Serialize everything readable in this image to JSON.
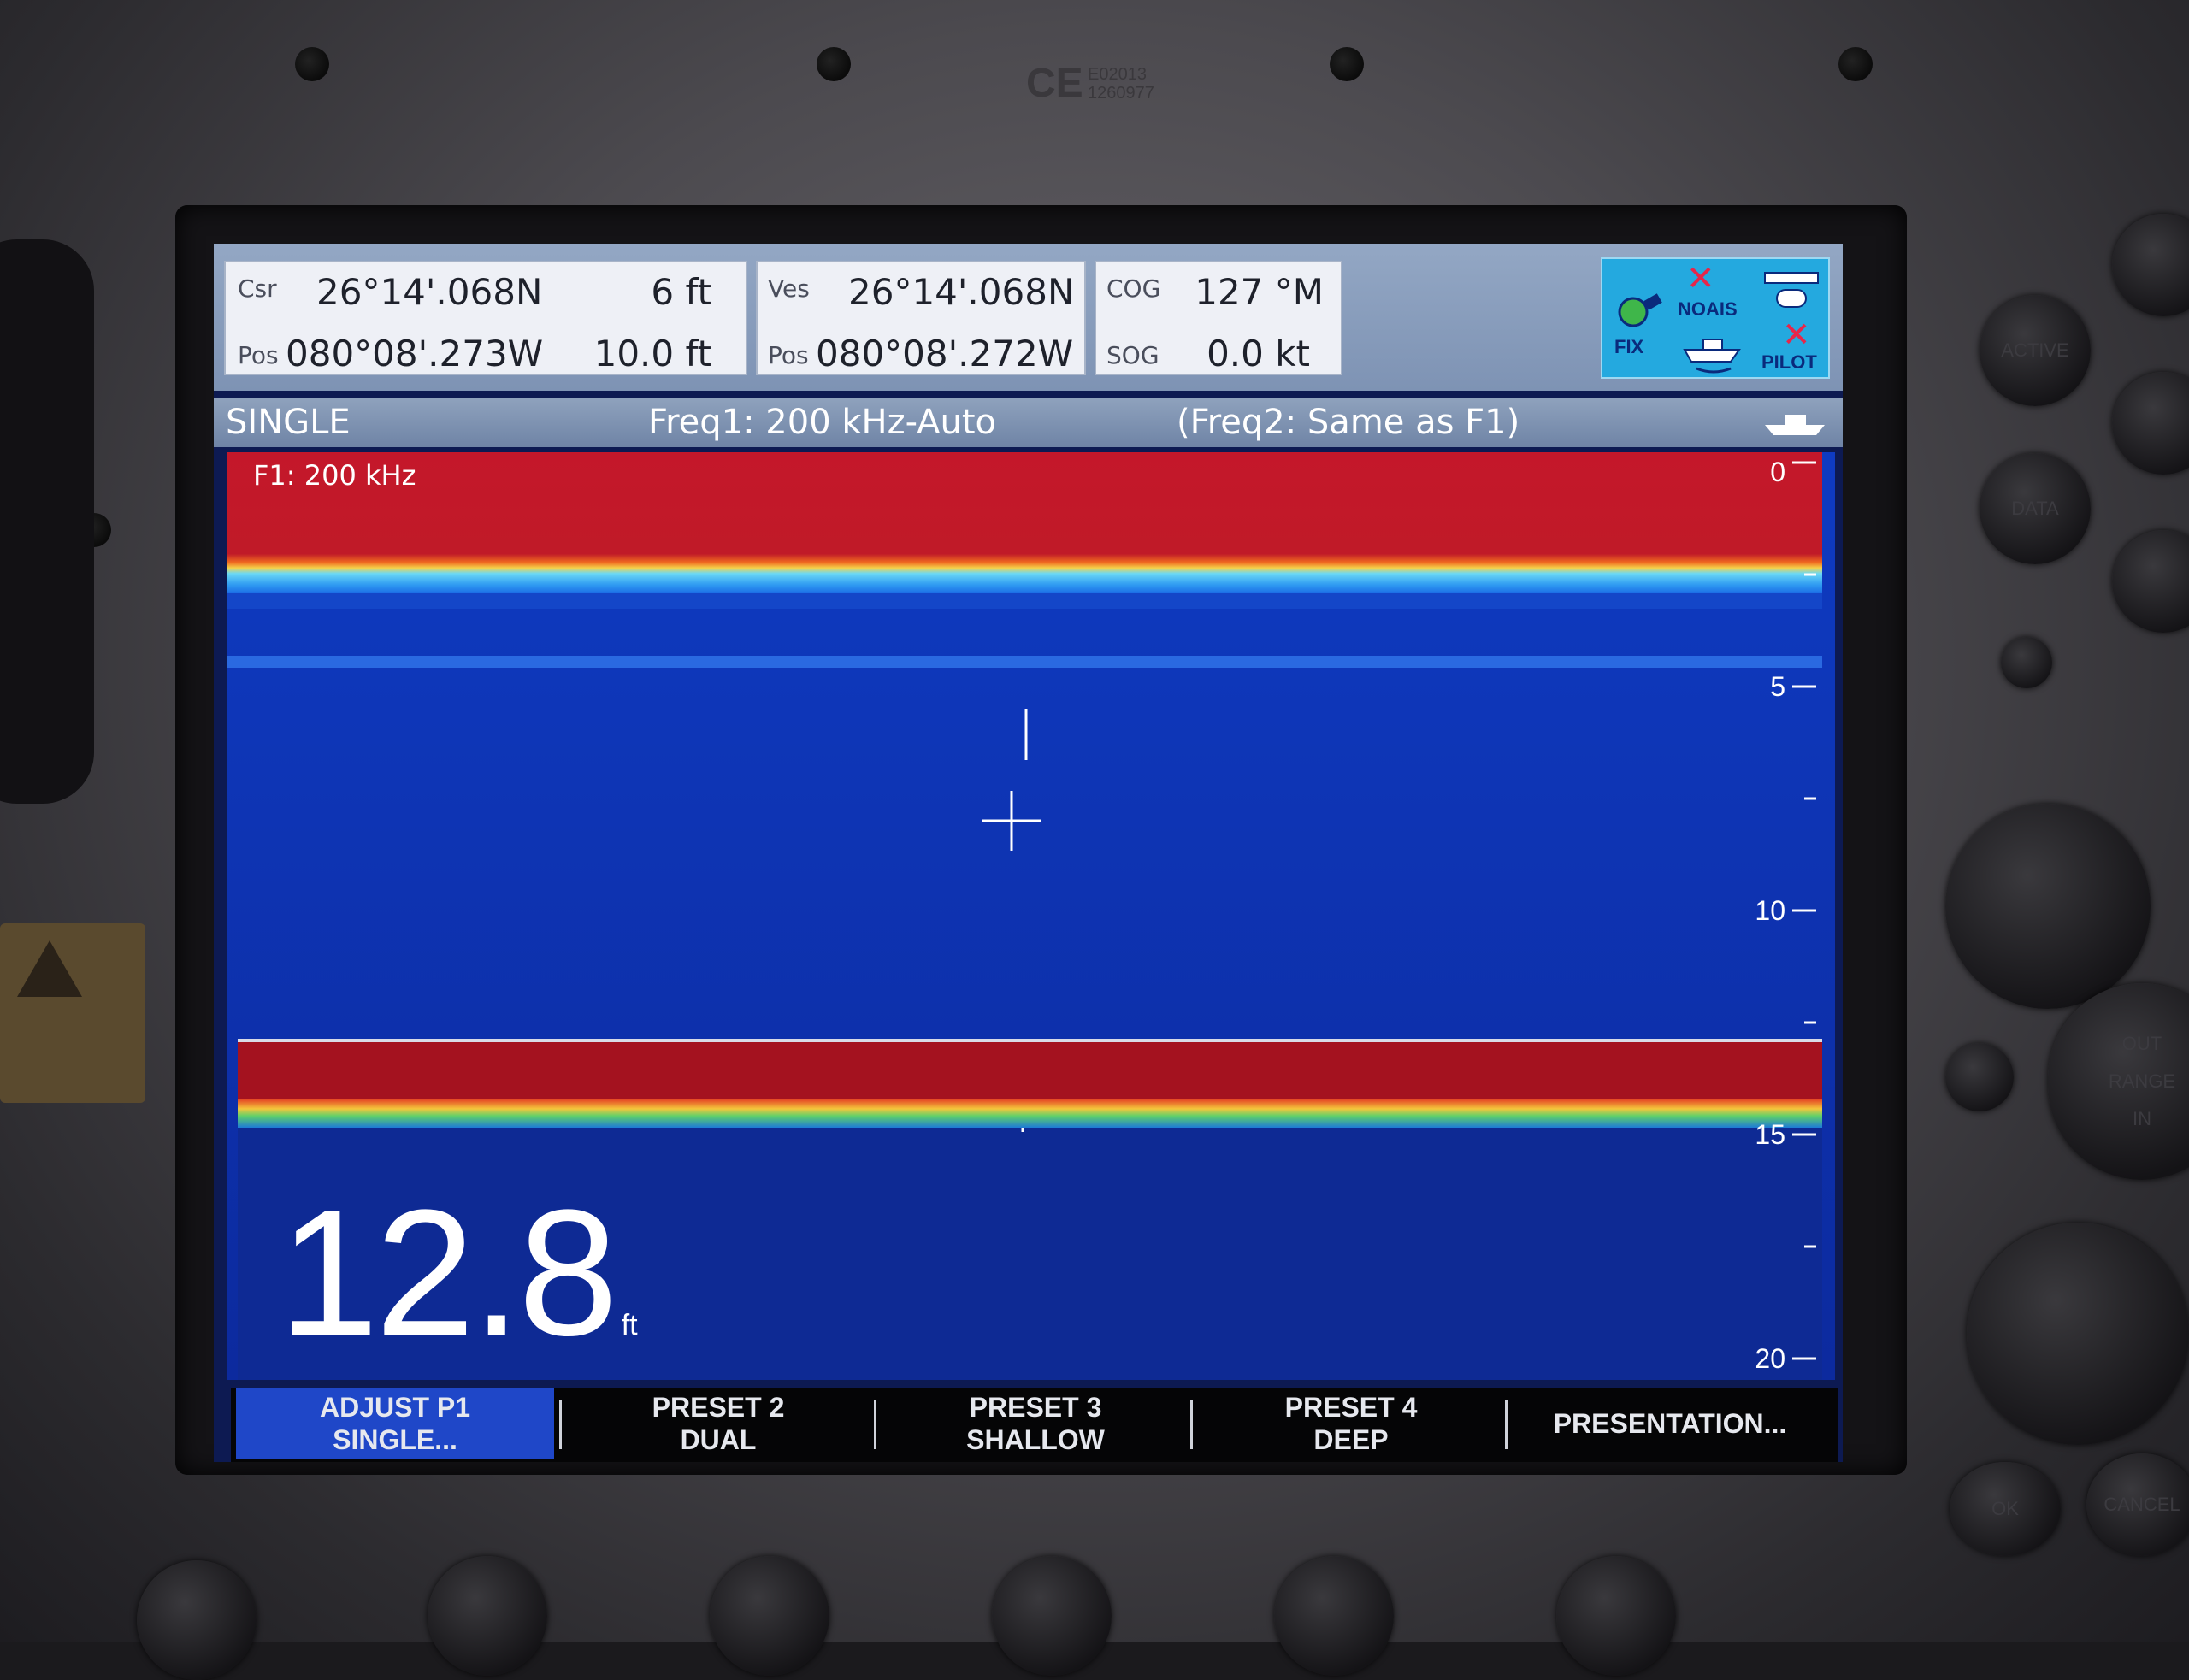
{
  "bezel": {
    "ce_mark": "CE",
    "ce_serial_1": "E02013",
    "ce_serial_2": "1260977",
    "buttons": [
      "ACTIVE",
      "DATA",
      "OUT",
      "RANGE",
      "IN",
      "OK",
      "CANCEL"
    ]
  },
  "databar": {
    "cursor": {
      "label_top": "Csr",
      "label_bottom": "Pos",
      "lat": "26°14'.068N",
      "lon": "080°08'.273W",
      "range": "6 ft",
      "depth": "10.0 ft"
    },
    "vessel": {
      "label_top": "Ves",
      "label_bottom": "Pos",
      "lat": "26°14'.068N",
      "lon": "080°08'.272W"
    },
    "nav": {
      "cog_label": "COG",
      "cog_value": "127 °M",
      "sog_label": "SOG",
      "sog_value": "0.0 kt"
    },
    "status": {
      "fix": "FIX",
      "noais": "NOAIS",
      "pilot": "PILOT",
      "icons": [
        "gps-fix-icon",
        "no-ais-icon",
        "sonar-module-icon",
        "boat-icon",
        "pilot-off-icon"
      ]
    }
  },
  "modebar": {
    "mode": "SINGLE",
    "freq1": "Freq1: 200 kHz-Auto",
    "freq2": "(Freq2: Same as F1)",
    "boat_icon": "boat-icon"
  },
  "sonar": {
    "channel_label": "F1: 200 kHz",
    "depth_value": "12.8",
    "depth_unit": "ft",
    "scale_labels": [
      "0",
      "5",
      "10",
      "15",
      "20"
    ],
    "colors": {
      "water": "#0f2fae",
      "surface_clutter": "#c4172a",
      "bottom": "#a4121f",
      "noise_band": "#2a8af0"
    }
  },
  "softkeys": [
    {
      "line1": "ADJUST P1",
      "line2": "SINGLE..."
    },
    {
      "line1": "PRESET 2",
      "line2": "DUAL"
    },
    {
      "line1": "PRESET 3",
      "line2": "SHALLOW"
    },
    {
      "line1": "PRESET 4",
      "line2": "DEEP"
    },
    {
      "line1": "PRESENTATION...",
      "line2": ""
    }
  ]
}
